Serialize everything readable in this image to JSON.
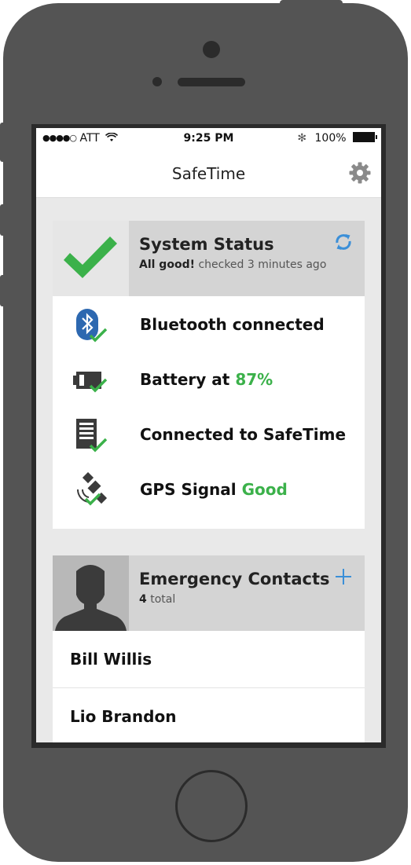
{
  "status_bar": {
    "signal_dots": "●●●●○",
    "carrier": "ATT",
    "time": "9:25 PM",
    "bluetooth": "✻",
    "battery": "100%"
  },
  "nav": {
    "title": "SafeTime"
  },
  "system_status": {
    "title": "System Status",
    "sub_bold": "All good!",
    "sub_rest": "checked 3 minutes ago",
    "items": [
      {
        "label": "Bluetooth connected",
        "value": ""
      },
      {
        "label": "Battery at",
        "value": "87%"
      },
      {
        "label": "Connected to SafeTime",
        "value": ""
      },
      {
        "label": "GPS Signal",
        "value": "Good"
      }
    ]
  },
  "emergency_contacts": {
    "title": "Emergency Contacts",
    "count": "4",
    "count_suffix": "total",
    "contacts": [
      {
        "name": "Bill Willis"
      },
      {
        "name": "Lio Brandon"
      }
    ]
  },
  "colors": {
    "accent_green": "#3bb14a",
    "accent_blue": "#3b8fd8",
    "header_gray": "#d4d4d4"
  }
}
